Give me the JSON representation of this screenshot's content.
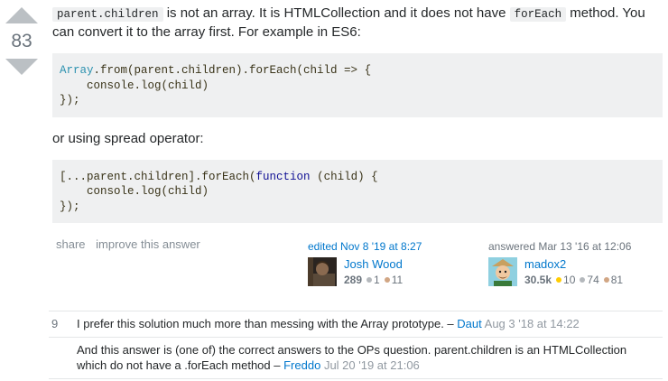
{
  "vote": {
    "score": "83"
  },
  "answer": {
    "intro_code1": "parent.children",
    "intro_text1": " is not an array. It is HTMLCollection and it does not have ",
    "intro_code2": "forEach",
    "intro_text2": " method. You can convert it to the array first. For example in ES6:",
    "code1": {
      "type": "Array",
      "line1_rest": ".from(parent.children).forEach(child => {",
      "line2": "    console.log(child)",
      "line3": "});"
    },
    "middle_text": "or using spread operator:",
    "code2": {
      "line1_pre": "[...parent.children].forEach(",
      "keyword": "function",
      "line1_post": " (child) {",
      "line2": "    console.log(child)",
      "line3": "});"
    }
  },
  "menu": {
    "share": "share",
    "improve": "improve this answer"
  },
  "edited": {
    "action": "edited Nov 8 '19 at 8:27",
    "user": "Josh Wood",
    "rep": "289",
    "silver": "1",
    "bronze": "11"
  },
  "answered": {
    "action": "answered Mar 13 '16 at 12:06",
    "user": "madox2",
    "rep": "30.5k",
    "gold": "10",
    "silver": "74",
    "bronze": "81"
  },
  "comments": [
    {
      "score": "9",
      "text": "I prefer this solution much more than messing with the Array prototype.",
      "dash": " – ",
      "user": "Daut",
      "date": "Aug 3 '18 at 14:22"
    },
    {
      "score": "",
      "text": "And this answer is (one of) the correct answers to the OPs question. parent.children is an HTMLCollection which do not have a .forEach method",
      "dash": " – ",
      "user": "Freddo",
      "date": "Jul 20 '19 at 21:06"
    }
  ],
  "colors": {
    "link": "#0077cc",
    "code_bg": "#eff0f1",
    "vote_arrow": "#bbc0c4"
  }
}
